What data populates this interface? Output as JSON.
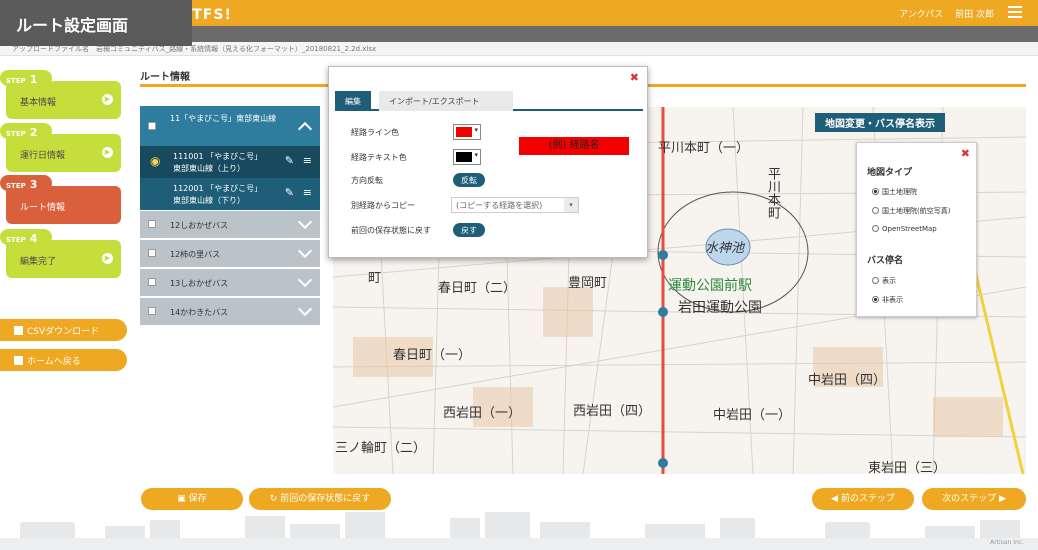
{
  "caption": "ルート設定画面",
  "header": {
    "brand": "カンタンGTFS!",
    "user": "アンクパス　 前田 次郎"
  },
  "file_bar": "アップロードファイル名　岩槻コミュニティバス_路線・系統情報（見える化フォーマット）_20180821_2.2d.xlsx",
  "steps": [
    {
      "tag": "STEP",
      "num": "1",
      "label": "基本情報"
    },
    {
      "tag": "STEP",
      "num": "2",
      "label": "運行日情報"
    },
    {
      "tag": "STEP",
      "num": "3",
      "label": "ルート情報"
    },
    {
      "tag": "STEP",
      "num": "4",
      "label": "編集完了"
    }
  ],
  "side_buttons": {
    "csv": "CSVダウンロード",
    "home": "ホームへ戻る"
  },
  "route": {
    "title": "ルート情報",
    "head": "11「やまびこ号」東部東山線",
    "subs": [
      {
        "id": "111001",
        "l1": "111001 「やまびこ号」",
        "l2": "東部東山線（上り）"
      },
      {
        "id": "112001",
        "l1": "112001 「やまびこ号」",
        "l2": "東部東山線（下り）"
      }
    ],
    "others": [
      "12しおかぜバス",
      "12柿の里バス",
      "13しおかぜバス",
      "14かわきたバス"
    ]
  },
  "dialog": {
    "tab_edit": "編集",
    "tab_io": "インポート/エクスポート",
    "line_color_label": "経路ライン色",
    "text_color_label": "経路テキスト色",
    "reverse_label": "方向反転",
    "reverse_btn": "反転",
    "copy_label": "別経路からコピー",
    "copy_placeholder": "(コピーする経路を選択)",
    "restore_label": "前回の保存状態に戻す",
    "restore_btn": "戻す",
    "sample": "(例) 経路名",
    "line_color": "#f30000",
    "text_color": "#000000"
  },
  "map": {
    "toolbar": "地図変更・バス停名表示",
    "labels": [
      "平川本町（一）",
      "水神池",
      "運動公園前駅",
      "岩田運動公園",
      "春日町（二）",
      "豊岡町",
      "春日町（一）",
      "西岩田（一）",
      "西岩田（四）",
      "中岩田（一）",
      "中岩田（四）",
      "東岩田（三）",
      "三ノ輪町（二）",
      "平川本町",
      "町"
    ],
    "panel": {
      "type_title": "地図タイプ",
      "types": [
        "国土地理院",
        "国土地理院(航空写真)",
        "OpenStreetMap"
      ],
      "stop_title": "バス停名",
      "stops": [
        "表示",
        "非表示"
      ]
    }
  },
  "bottom": {
    "save": "保存",
    "restore": "前回の保存状態に戻す",
    "prev": "◀ 前のステップ",
    "next": "次のステップ ▶"
  },
  "footer": "Artisan Inc."
}
